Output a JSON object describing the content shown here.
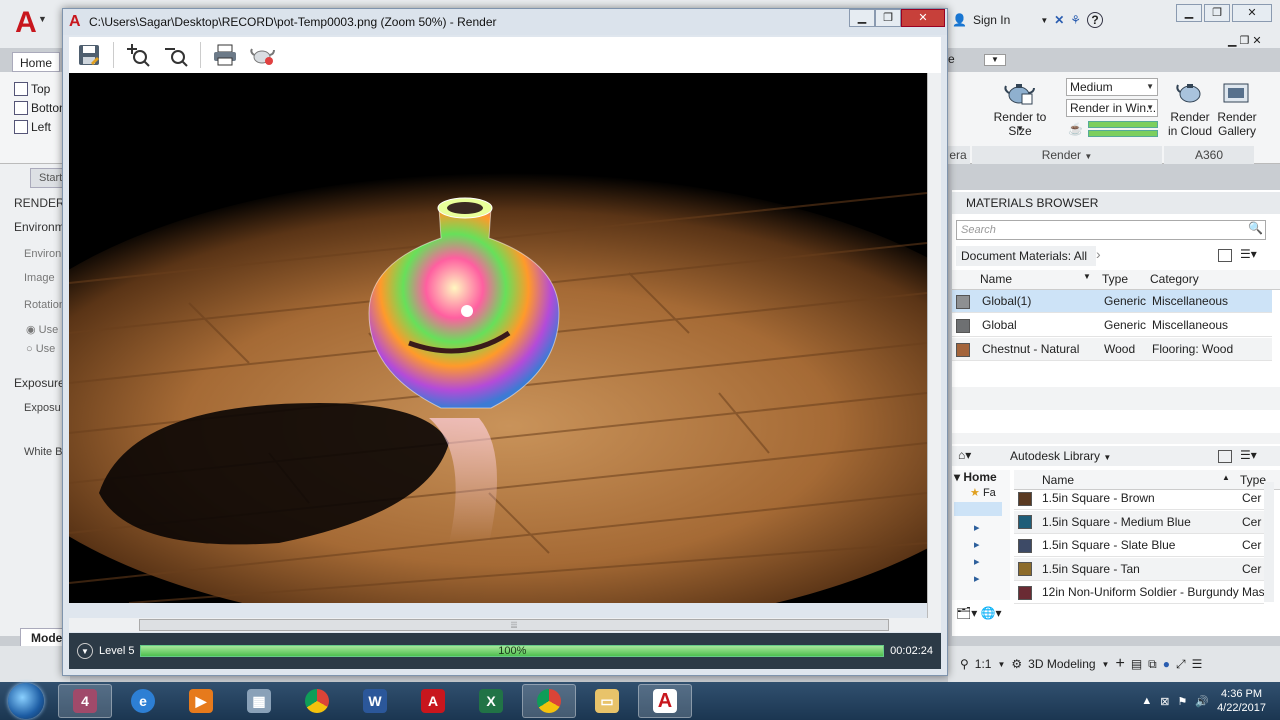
{
  "app": {
    "sign_in": "Sign In",
    "home_tab": "Home",
    "views": [
      "Top",
      "Bottom",
      "Left"
    ],
    "start_tab": "Start",
    "model_tab": "Model"
  },
  "left_panel": {
    "title": "RENDER",
    "environment": "Environment",
    "environ": "Environ",
    "image": "Image",
    "rotation": "Rotation",
    "use1": "Use",
    "use2": "Use",
    "exposure_hd": "Exposure",
    "exposure": "Exposu",
    "white": "White B"
  },
  "ribbon": {
    "render_to_size": "Render to Size",
    "quality": "Medium",
    "render_in": "Render in Win...",
    "render_in_cloud": "Render in Cloud",
    "render_gallery": "Render Gallery",
    "panel_render": "Render",
    "panel_a360": "A360",
    "panel_frag": "era"
  },
  "render_window": {
    "title": "C:\\Users\\Sagar\\Desktop\\RECORD\\pot-Temp0003.png (Zoom 50%) - Render",
    "level": "Level 5",
    "progress_text": "100%",
    "progress_value": 100,
    "elapsed": "00:02:24"
  },
  "materials_browser": {
    "title": "MATERIALS BROWSER",
    "search_placeholder": "Search",
    "filter": "Document Materials: All",
    "columns": [
      "Name",
      "Type",
      "Category"
    ],
    "rows": [
      {
        "name": "Global(1)",
        "type": "Generic",
        "category": "Miscellaneous",
        "swatch": "#8e9092"
      },
      {
        "name": "Global",
        "type": "Generic",
        "category": "Miscellaneous",
        "swatch": "#6e7072"
      },
      {
        "name": "Chestnut - Natural",
        "type": "Wood",
        "category": "Flooring: Wood",
        "swatch": "#a3643b"
      }
    ],
    "library": "Autodesk Library",
    "lib_columns": [
      "Name",
      "Type"
    ],
    "tree": [
      "Home",
      "Fa"
    ],
    "lib_rows": [
      {
        "name": "1.5in Square - Brown",
        "type": "Cer",
        "swatch": "#5a3a22"
      },
      {
        "name": "1.5in Square - Medium Blue",
        "type": "Cer",
        "swatch": "#1e5d78"
      },
      {
        "name": "1.5in Square - Slate Blue",
        "type": "Cer",
        "swatch": "#3d4a66"
      },
      {
        "name": "1.5in Square - Tan",
        "type": "Cer",
        "swatch": "#8c6b2a"
      },
      {
        "name": "12in Non-Uniform Soldier - Burgundy",
        "type": "Mas",
        "swatch": "#6a2b33"
      }
    ]
  },
  "status_bar": {
    "scale": "1:1",
    "workspace": "3D Modeling"
  },
  "taskbar": {
    "time": "4:36 PM",
    "date": "4/22/2017",
    "badge": "4"
  }
}
